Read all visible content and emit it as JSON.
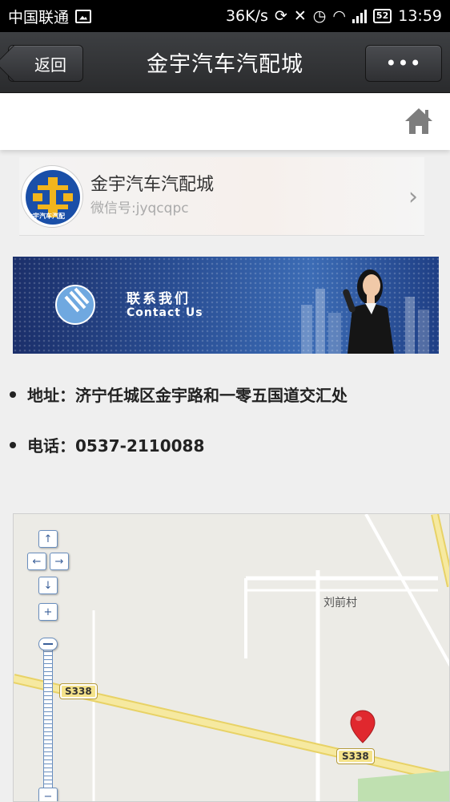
{
  "status_bar": {
    "carrier": "中国联通",
    "speed": "36K/s",
    "battery": "52",
    "time": "13:59"
  },
  "header": {
    "back_label": "返回",
    "title": "金宇汽车汽配城",
    "more_label": "•••"
  },
  "account": {
    "name": "金宇汽车汽配城",
    "wechat_id": "微信号:jyqcqpc",
    "avatar_text": "金宇汽车汽配"
  },
  "banner": {
    "title": "联系我们",
    "subtitle": "Contact Us"
  },
  "contact": {
    "address": "地址：济宁任城区金宇路和一零五国道交汇处",
    "phone": "电话：0537-2110088"
  },
  "map": {
    "road_label_1": "S338",
    "road_label_2": "S338",
    "village": "刘前村",
    "controls": {
      "up": "↑",
      "left": "←",
      "right": "→",
      "down": "↓",
      "zoom_in": "+",
      "zoom_out": "−"
    }
  },
  "icons": {
    "home": "home-icon",
    "chevron": "chevron-right-icon",
    "marker": "map-marker-icon"
  },
  "colors": {
    "header_bg": "#2f3033",
    "marker": "#e0282e",
    "road": "#f4e28a"
  }
}
